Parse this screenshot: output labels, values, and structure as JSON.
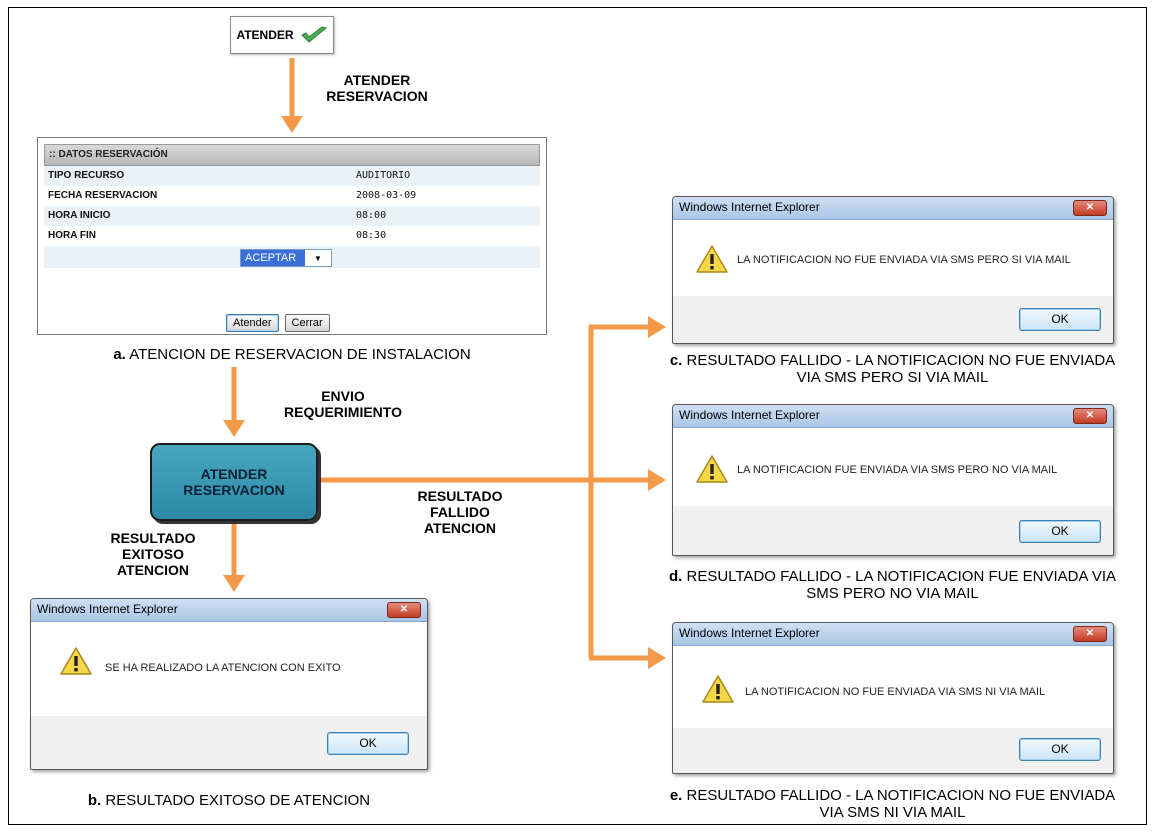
{
  "top_button": {
    "label": "ATENDER",
    "icon": "check-icon",
    "check_color": "#4caf50"
  },
  "edges": {
    "to_form": "ATENDER\nRESERVACION",
    "to_process": "ENVIO\nREQUERIMIENTO",
    "success": "RESULTADO\nEXITOSO\nATENCION",
    "failure": "RESULTADO\nFALLIDO\nATENCION"
  },
  "form": {
    "header": ":: DATOS RESERVACIÓN",
    "rows": [
      {
        "label": "TIPO RECURSO",
        "value": "AUDITORIO"
      },
      {
        "label": "FECHA RESERVACION",
        "value": "2008-03-09"
      },
      {
        "label": "HORA INICIO",
        "value": "08:00"
      },
      {
        "label": "HORA FIN",
        "value": "08:30"
      }
    ],
    "select_value": "ACEPTAR",
    "buttons": {
      "primary": "Atender",
      "secondary": "Cerrar"
    },
    "caption": "a. ATENCION DE RESERVACION DE INSTALACION"
  },
  "process": {
    "label": "ATENDER\nRESERVACION",
    "fill": "#3b9bb6"
  },
  "dialogs": {
    "b": {
      "title": "Windows Internet Explorer",
      "message": "SE HA REALIZADO LA ATENCION CON EXITO",
      "ok": "OK",
      "caption": "b. RESULTADO EXITOSO DE ATENCION"
    },
    "c": {
      "title": "Windows Internet Explorer",
      "message": "LA NOTIFICACION NO FUE ENVIADA VIA SMS PERO SI VIA MAIL",
      "ok": "OK",
      "caption": "c. RESULTADO FALLIDO - LA NOTIFICACION NO FUE ENVIADA\nVIA SMS PERO SI VIA MAIL"
    },
    "d": {
      "title": "Windows Internet Explorer",
      "message": "LA NOTIFICACION FUE ENVIADA VIA SMS PERO NO VIA MAIL",
      "ok": "OK",
      "caption": "d. RESULTADO FALLIDO - LA NOTIFICACION FUE ENVIADA VIA\nSMS PERO NO VIA MAIL"
    },
    "e": {
      "title": "Windows Internet Explorer",
      "message": "LA NOTIFICACION NO FUE ENVIADA VIA SMS NI VIA MAIL",
      "ok": "OK",
      "caption": "e. RESULTADO FALLIDO - LA NOTIFICACION NO FUE ENVIADA\nVIA SMS NI VIA MAIL"
    }
  },
  "colors": {
    "arrow": "#f39a4a",
    "dialog_title_bar": "#b9d1ec",
    "close_button": "#c9452d"
  }
}
